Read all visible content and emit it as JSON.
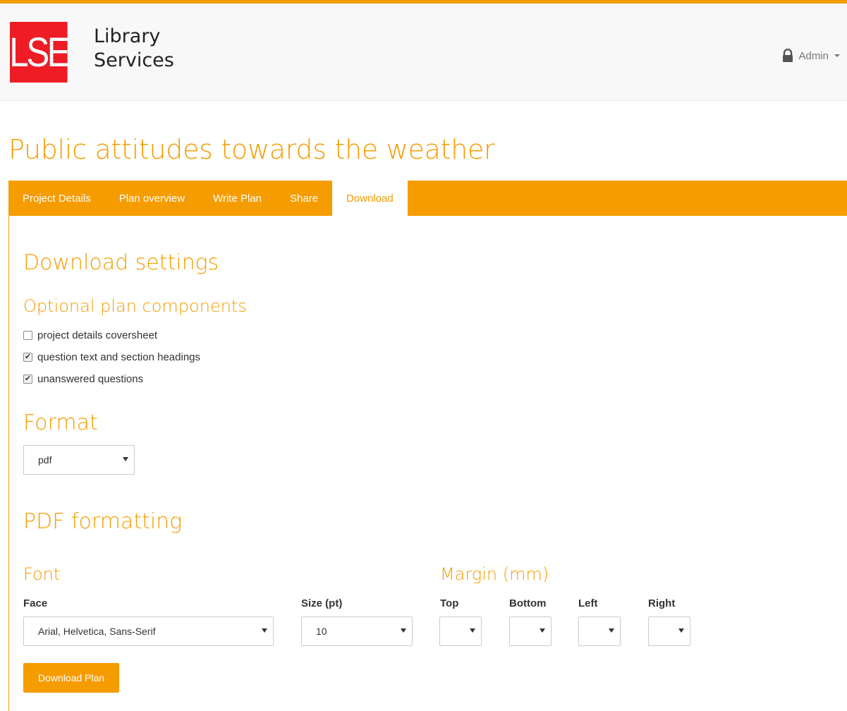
{
  "header": {
    "logo_mark": "LSE",
    "logo_line1": "Library",
    "logo_line2": "Services",
    "user_menu_label": "Admin"
  },
  "page": {
    "title": "Public attitudes towards the weather"
  },
  "tabs": [
    {
      "label": "Project Details",
      "active": false
    },
    {
      "label": "Plan overview",
      "active": false
    },
    {
      "label": "Write Plan",
      "active": false
    },
    {
      "label": "Share",
      "active": false
    },
    {
      "label": "Download",
      "active": true
    }
  ],
  "download_settings": {
    "heading": "Download settings",
    "optional_heading": "Optional plan components",
    "options": [
      {
        "label": "project details coversheet",
        "checked": false
      },
      {
        "label": "question text and section headings",
        "checked": true
      },
      {
        "label": "unanswered questions",
        "checked": true
      }
    ]
  },
  "format": {
    "heading": "Format",
    "selected": "pdf"
  },
  "pdf_formatting": {
    "heading": "PDF formatting",
    "font_heading": "Font",
    "margin_heading": "Margin (mm)",
    "face_label": "Face",
    "face_value": "Arial, Helvetica, Sans-Serif",
    "size_label": "Size (pt)",
    "size_value": "10",
    "top_label": "Top",
    "bottom_label": "Bottom",
    "left_label": "Left",
    "right_label": "Right",
    "top_value": "",
    "bottom_value": "",
    "left_value": "",
    "right_value": ""
  },
  "actions": {
    "download_label": "Download Plan"
  },
  "colors": {
    "accent": "#f59c00",
    "logo_red": "#ee1c25"
  }
}
